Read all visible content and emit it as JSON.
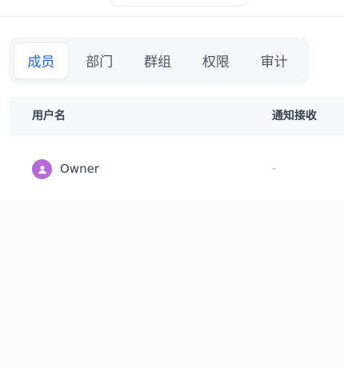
{
  "tabs": [
    {
      "label": "成员",
      "active": true
    },
    {
      "label": "部门",
      "active": false
    },
    {
      "label": "群组",
      "active": false
    },
    {
      "label": "权限",
      "active": false
    },
    {
      "label": "审计",
      "active": false
    }
  ],
  "table": {
    "headers": {
      "username": "用户名",
      "notify": "通知接收"
    },
    "rows": [
      {
        "avatar_icon": "user-icon",
        "username": "Owner",
        "notify": "-"
      }
    ]
  },
  "colors": {
    "accent": "#2563eb",
    "avatar": "#b56ad6"
  }
}
